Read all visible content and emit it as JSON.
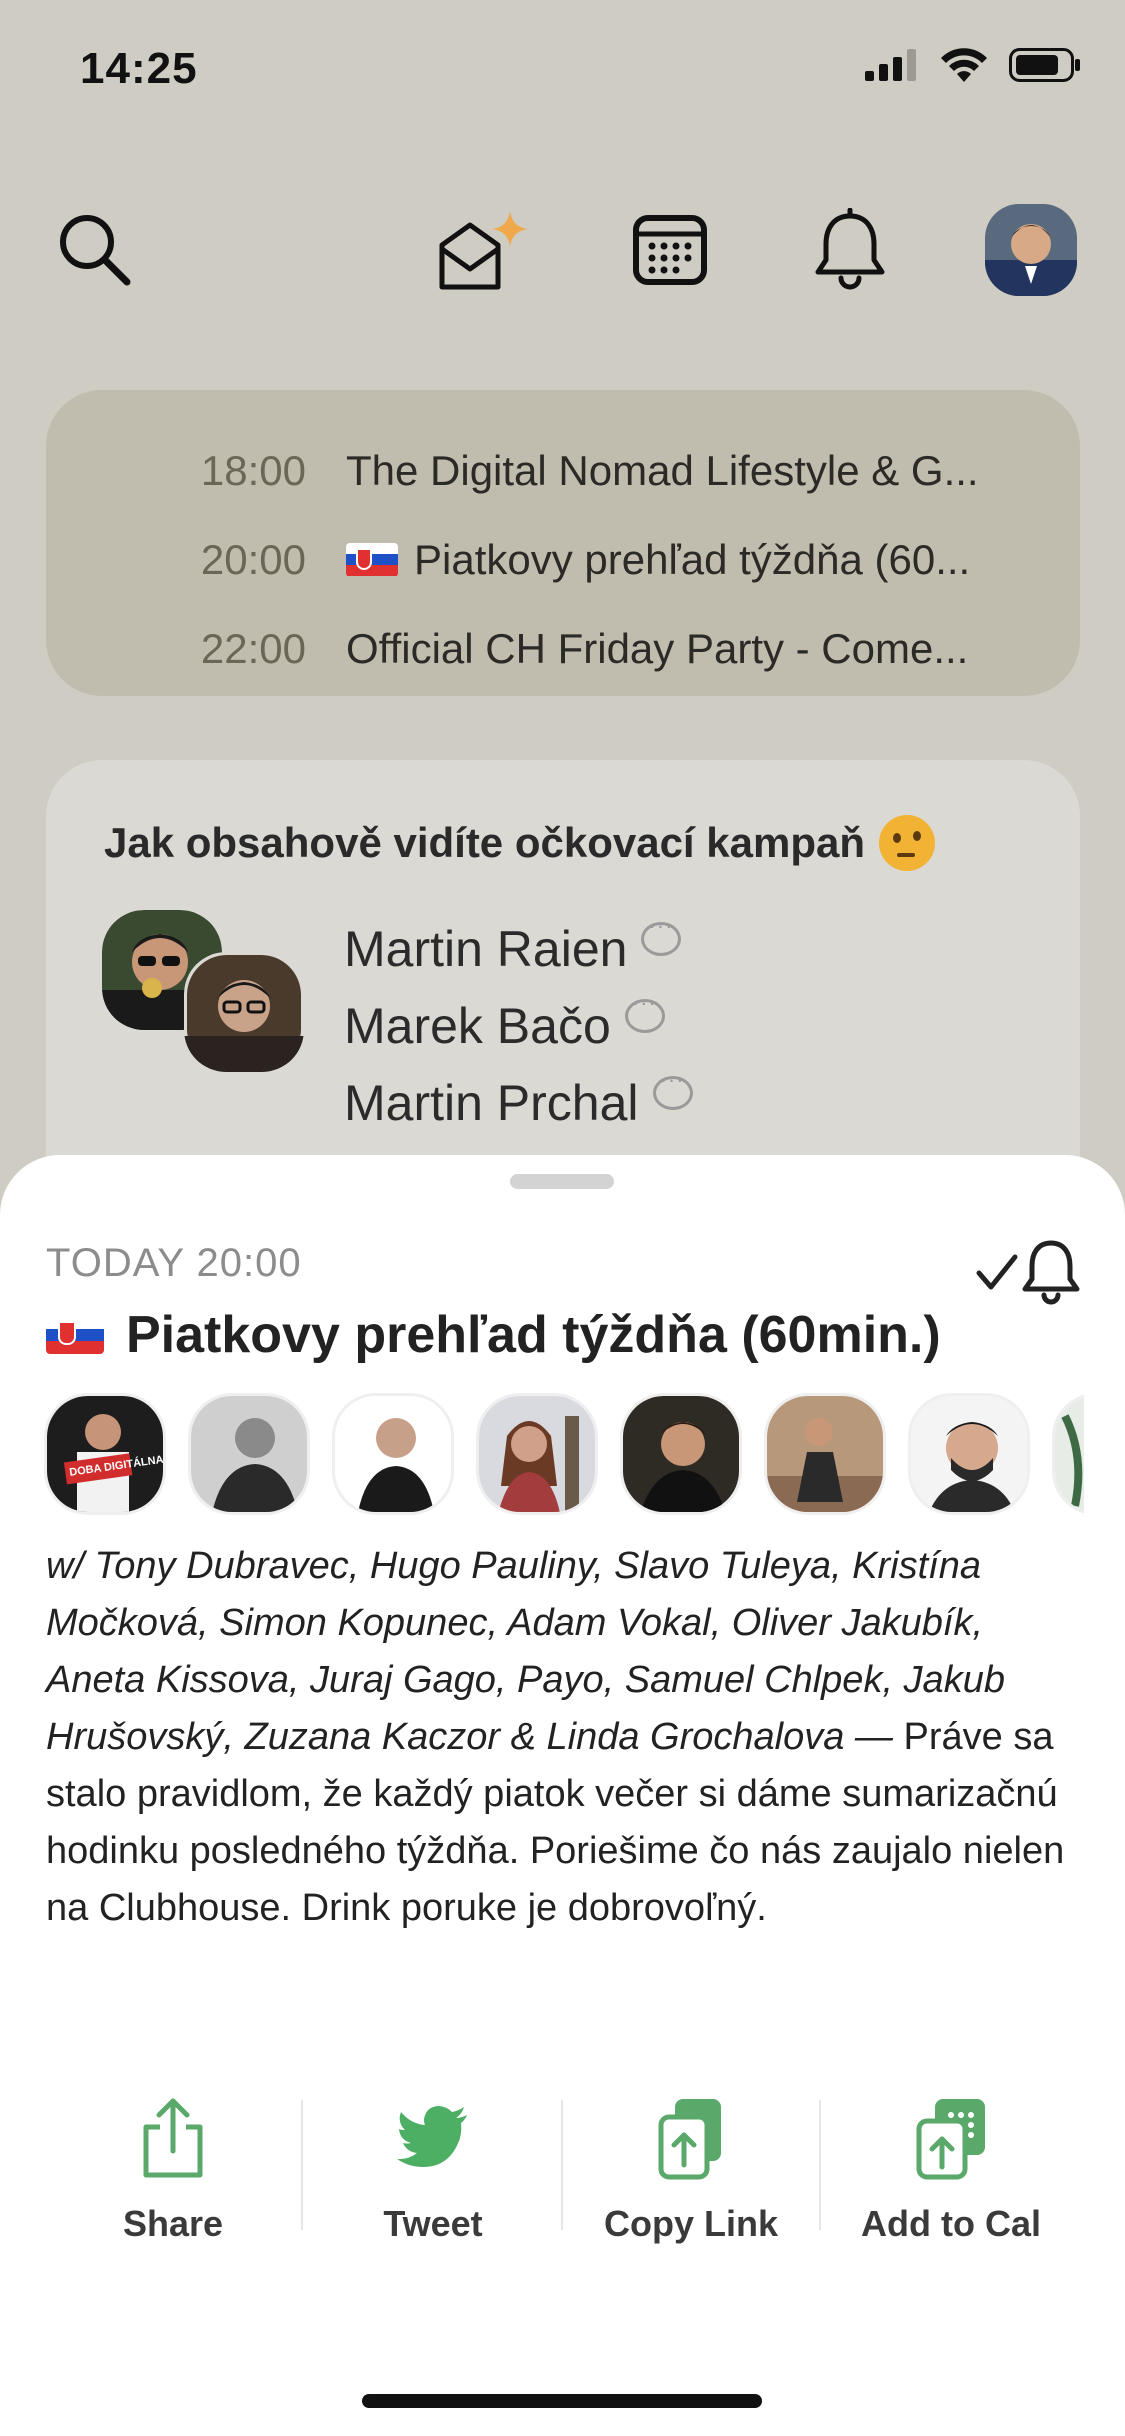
{
  "status_bar": {
    "time": "14:25"
  },
  "upcoming": [
    {
      "time": "18:00",
      "title": "The Digital Nomad Lifestyle & G...",
      "flag": false
    },
    {
      "time": "20:00",
      "title": "Piatkovy prehľad týždňa (60...",
      "flag": true
    },
    {
      "time": "22:00",
      "title": "Official CH Friday Party - Come...",
      "flag": false
    }
  ],
  "room": {
    "title": "Jak obsahově vidíte očkovací kampaň",
    "speakers": [
      "Martin Raien",
      "Marek Bačo",
      "Martin Prchal"
    ]
  },
  "event": {
    "when": "TODAY 20:00",
    "title": "Piatkovy prehľad týždňa (60min.)",
    "avatar_badge": "DOBA DIGITÁLNA",
    "hosts": "w/ Tony Dubravec, Hugo Pauliny, Slavo Tuleya, Kristína Močková, Simon Kopunec, Adam Vokal, Oliver Jakubík, Aneta Kissova, Juraj Gago, Payo, Samuel Chlpek, Jakub Hrušovský, Zuzana Kaczor & Linda Grochalova —",
    "description": "Práve sa stalo pravidlom, že každý piatok večer si dáme sumarizačnú hodinku posledného týždňa. Poriešime čo nás zaujalo nielen na Clubhouse. Drink poruke je dobrovoľný."
  },
  "actions": {
    "share": "Share",
    "tweet": "Tweet",
    "copy_link": "Copy Link",
    "add_to_cal": "Add to Cal"
  },
  "colors": {
    "background": "#ceccc3",
    "upcoming_card": "#c1bdae",
    "room_card": "#dad9d4",
    "action_green": "#5aa96a",
    "tweet_green": "#4caf63",
    "star": "#f0a94a"
  }
}
